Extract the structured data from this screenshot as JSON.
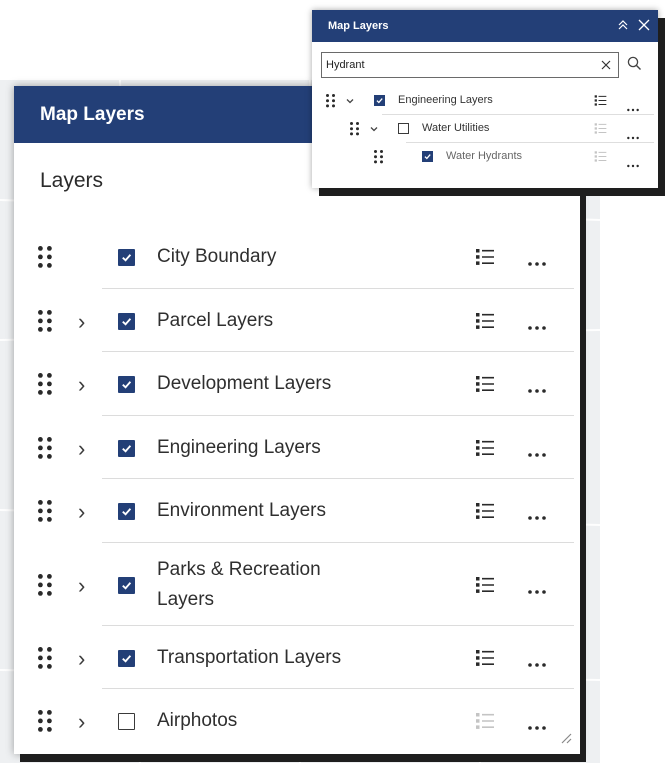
{
  "main_panel": {
    "title": "Map Layers",
    "section_title": "Layers",
    "layers": [
      {
        "label": "City Boundary",
        "checked": true,
        "expandable": false,
        "legend_active": true
      },
      {
        "label": "Parcel Layers",
        "checked": true,
        "expandable": true,
        "legend_active": true
      },
      {
        "label": "Development Layers",
        "checked": true,
        "expandable": true,
        "legend_active": true
      },
      {
        "label": "Engineering Layers",
        "checked": true,
        "expandable": true,
        "legend_active": true
      },
      {
        "label": "Environment Layers",
        "checked": true,
        "expandable": true,
        "legend_active": true
      },
      {
        "label": "Parks & Recreation",
        "label_line2": "Layers",
        "checked": true,
        "expandable": true,
        "legend_active": true
      },
      {
        "label": "Transportation Layers",
        "checked": true,
        "expandable": true,
        "legend_active": true
      },
      {
        "label": "Airphotos",
        "checked": false,
        "expandable": true,
        "legend_active": false
      }
    ]
  },
  "search_panel": {
    "title": "Map Layers",
    "search": {
      "value": "Hydrant"
    },
    "results": [
      {
        "label": "Engineering Layers",
        "checked": true,
        "depth": 0,
        "expanded": true,
        "legend_active": true
      },
      {
        "label": "Water Utilities",
        "checked": false,
        "depth": 1,
        "expanded": true,
        "legend_active": false
      },
      {
        "label": "Water Hydrants",
        "checked": true,
        "depth": 2,
        "expanded": false,
        "legend_active": false
      }
    ]
  },
  "icons": {
    "drag": "drag-handle-icon",
    "chevron": "chevron-icon",
    "legend": "legend-list-icon",
    "more": "more-options-icon",
    "collapse": "collapse-icon",
    "close": "close-icon",
    "search": "search-icon",
    "clear": "clear-icon",
    "resize": "resize-handle-icon"
  },
  "colors": {
    "header": "#233f77",
    "checkbox_checked": "#233f77"
  }
}
